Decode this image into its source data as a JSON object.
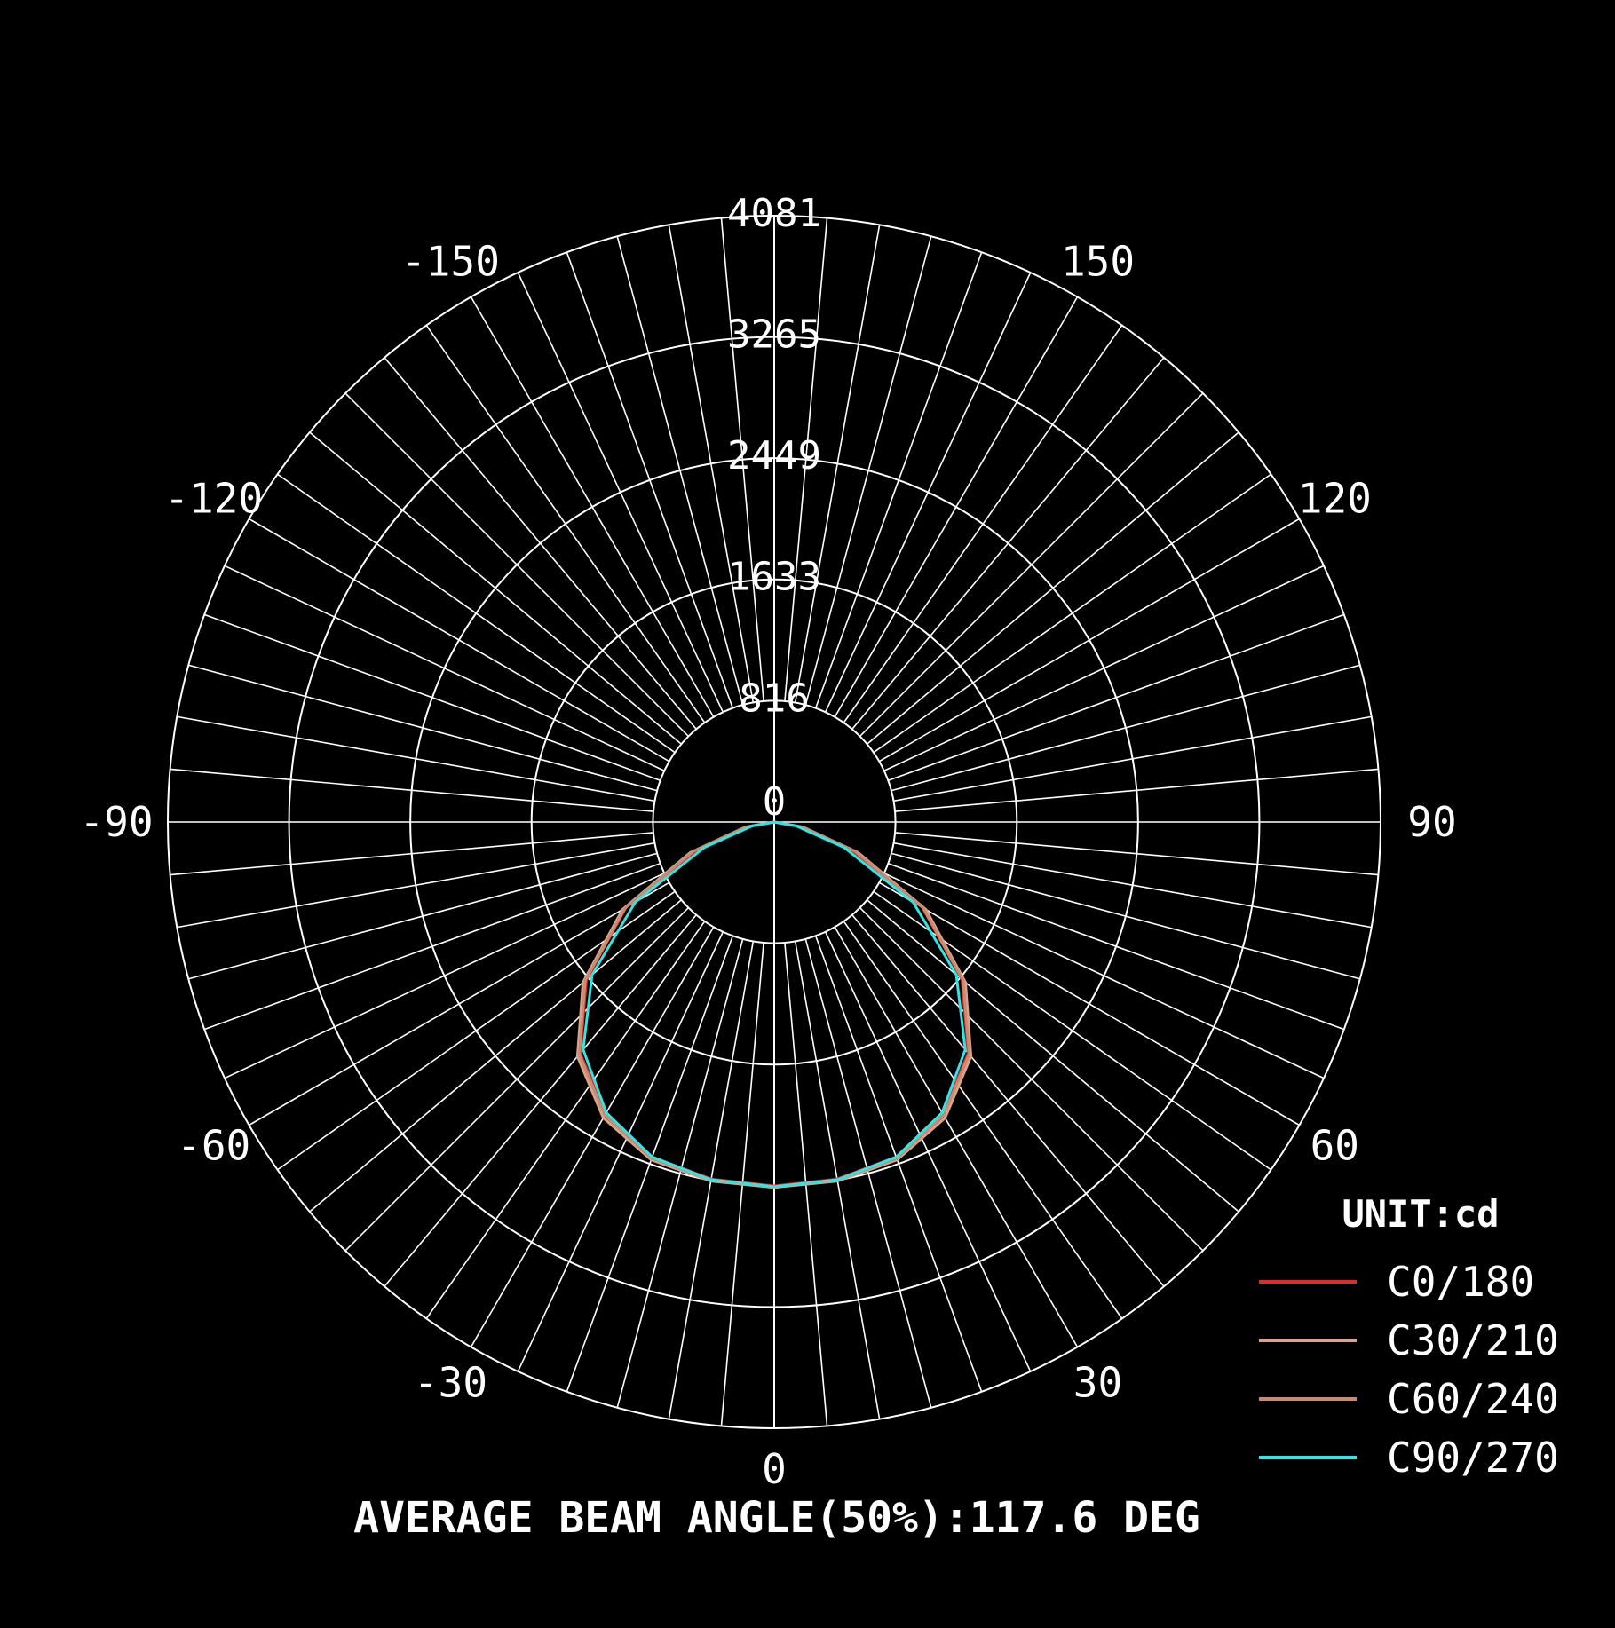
{
  "chart_data": {
    "type": "polar",
    "angle_labels": [
      {
        "text": "-150",
        "angle": -150
      },
      {
        "text": "150",
        "angle": 150
      },
      {
        "text": "-120",
        "angle": -120
      },
      {
        "text": "120",
        "angle": 120
      },
      {
        "text": "-90",
        "angle": -90
      },
      {
        "text": "90",
        "angle": 90
      },
      {
        "text": "-60",
        "angle": -60
      },
      {
        "text": "60",
        "angle": 60
      },
      {
        "text": "-30",
        "angle": -30
      },
      {
        "text": "30",
        "angle": 30
      },
      {
        "text": "0",
        "angle": 0
      }
    ],
    "radial_ticks": [
      0,
      816,
      1633,
      2449,
      3265,
      4081
    ],
    "radial_tick_labels": [
      "0",
      "816",
      "1633",
      "2449",
      "3265",
      "4081"
    ],
    "rlim": [
      0,
      4081
    ],
    "angle_grid_step_deg": 5,
    "grid": true,
    "unit_label": "UNIT:cd",
    "legend_position": "bottom-right",
    "series": [
      {
        "name": "C0/180",
        "color": "#e02a2a",
        "theta": [
          -90,
          -80,
          -70,
          -60,
          -50,
          -40,
          -30,
          -20,
          -10,
          0,
          10,
          20,
          30,
          40,
          50,
          60,
          70,
          80,
          90
        ],
        "r": [
          0,
          180,
          560,
          1150,
          1650,
          2030,
          2270,
          2400,
          2440,
          2450,
          2440,
          2400,
          2270,
          2030,
          1650,
          1150,
          560,
          180,
          0
        ]
      },
      {
        "name": "C30/210",
        "color": "#d9a38c",
        "theta": [
          -90,
          -80,
          -70,
          -60,
          -50,
          -40,
          -30,
          -20,
          -10,
          0,
          10,
          20,
          30,
          40,
          50,
          60,
          70,
          80,
          90
        ],
        "r": [
          0,
          200,
          600,
          1180,
          1680,
          2060,
          2300,
          2420,
          2455,
          2460,
          2455,
          2420,
          2300,
          2060,
          1680,
          1180,
          600,
          200,
          0
        ]
      },
      {
        "name": "C60/240",
        "color": "#c98a6e",
        "theta": [
          -90,
          -80,
          -70,
          -60,
          -50,
          -40,
          -30,
          -20,
          -10,
          0,
          10,
          20,
          30,
          40,
          50,
          60,
          70,
          80,
          90
        ],
        "r": [
          0,
          190,
          580,
          1160,
          1660,
          2040,
          2280,
          2410,
          2445,
          2455,
          2445,
          2410,
          2280,
          2040,
          1660,
          1160,
          580,
          190,
          0
        ]
      },
      {
        "name": "C90/270",
        "color": "#2ee6e6",
        "theta": [
          -90,
          -80,
          -70,
          -60,
          -50,
          -40,
          -30,
          -20,
          -10,
          0,
          10,
          20,
          30,
          40,
          50,
          60,
          70,
          80,
          90
        ],
        "r": [
          0,
          150,
          500,
          1080,
          1600,
          2000,
          2260,
          2400,
          2445,
          2455,
          2445,
          2400,
          2260,
          2000,
          1600,
          1080,
          500,
          150,
          0
        ]
      }
    ],
    "annotation": "AVERAGE BEAM ANGLE(50%):117.6 DEG"
  }
}
